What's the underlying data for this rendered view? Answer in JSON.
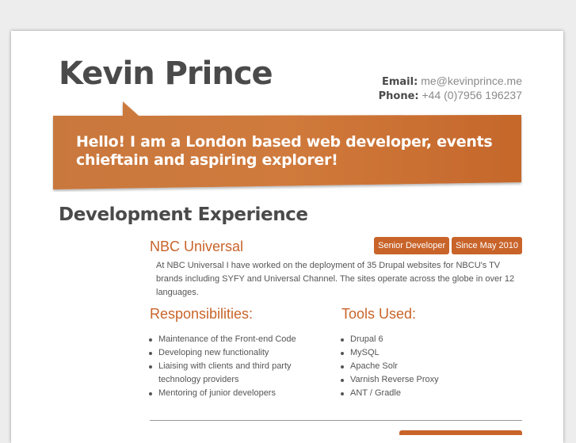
{
  "header": {
    "name": "Kevin Prince",
    "email_label": "Email:",
    "email": "me@kevinprince.me",
    "phone_label": "Phone:",
    "phone": "+44 (0)7956 196237"
  },
  "banner": {
    "line1": "Hello! I am a London based web developer, events",
    "line2": "chieftain and aspiring explorer!"
  },
  "section": {
    "title": "Development Experience"
  },
  "job": {
    "company": "NBC Universal",
    "role": "Senior Developer",
    "since": "Since May 2010",
    "description": "At NBC Universal I have worked on the deployment of 35 Drupal websites for NBCU's TV brands including SYFY and Universal Channel. The sites operate across the globe in over 12 languages.",
    "responsibilities_title": "Responsibilities:",
    "responsibilities": [
      "Maintenance of the Front-end Code",
      "Developing new functionality",
      "Liaising with clients and third party technology providers",
      "Mentoring of junior developers"
    ],
    "tools_title": "Tools Used:",
    "tools": [
      "Drupal 6",
      "MySQL",
      "Apache Solr",
      "Varnish Reverse Proxy",
      "ANT / Gradle"
    ]
  },
  "colors": {
    "accent": "#c8642a",
    "text_dark": "#4a4a4a",
    "background": "#ededed"
  }
}
